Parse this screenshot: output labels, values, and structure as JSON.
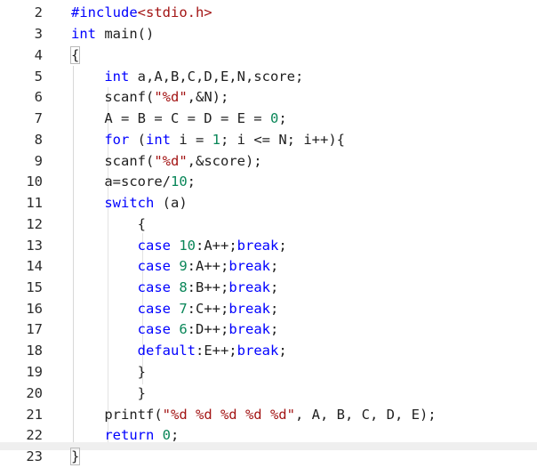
{
  "editor": {
    "lines": [
      {
        "num": "2",
        "code": "#include<stdio.h>"
      },
      {
        "num": "3",
        "code": "int main()"
      },
      {
        "num": "4",
        "code": "{"
      },
      {
        "num": "5",
        "code": "    int a,A,B,C,D,E,N,score;"
      },
      {
        "num": "6",
        "code": "    scanf(\"%d\",&N);"
      },
      {
        "num": "7",
        "code": "    A = B = C = D = E = 0;"
      },
      {
        "num": "8",
        "code": "    for (int i = 1; i <= N; i++){"
      },
      {
        "num": "9",
        "code": "    scanf(\"%d\",&score);"
      },
      {
        "num": "10",
        "code": "    a=score/10;"
      },
      {
        "num": "11",
        "code": "    switch (a)"
      },
      {
        "num": "12",
        "code": "        {"
      },
      {
        "num": "13",
        "code": "        case 10:A++;break;"
      },
      {
        "num": "14",
        "code": "        case 9:A++;break;"
      },
      {
        "num": "15",
        "code": "        case 8:B++;break;"
      },
      {
        "num": "16",
        "code": "        case 7:C++;break;"
      },
      {
        "num": "17",
        "code": "        case 6:D++;break;"
      },
      {
        "num": "18",
        "code": "        default:E++;break;"
      },
      {
        "num": "19",
        "code": "        }"
      },
      {
        "num": "20",
        "code": "        }"
      },
      {
        "num": "21",
        "code": "    printf(\"%d %d %d %d %d\", A, B, C, D, E);"
      },
      {
        "num": "22",
        "code": "    return 0;"
      },
      {
        "num": "23",
        "code": "}"
      }
    ]
  }
}
